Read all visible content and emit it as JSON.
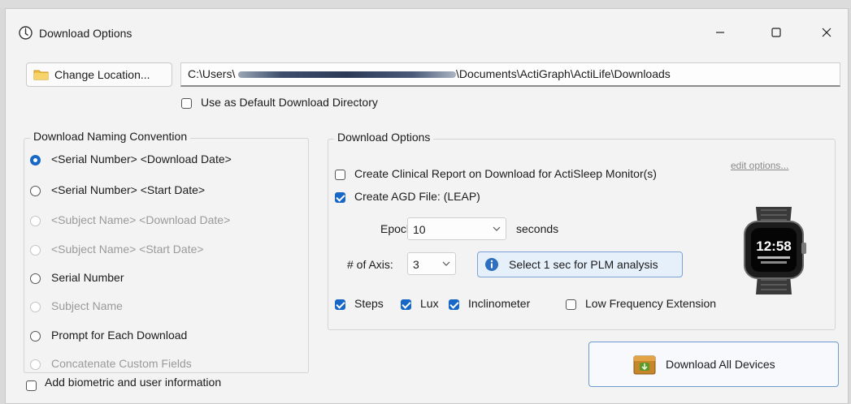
{
  "window": {
    "title": "Download Options",
    "icon": "download-clock-icon"
  },
  "controls": {
    "minimize_icon": "minimize-icon",
    "maximize_icon": "maximize-icon",
    "close_icon": "close-icon"
  },
  "location": {
    "button_label": "Change Location...",
    "path_prefix": "C:\\Users\\",
    "path_suffix": "\\Documents\\ActiGraph\\ActiLife\\Downloads",
    "default_label": "Use as Default Download Directory",
    "default_checked": false
  },
  "naming": {
    "title": "Download Naming Convention",
    "options": [
      {
        "label": "<Serial Number> <Download Date>",
        "selected": true,
        "disabled": false
      },
      {
        "label": "<Serial Number> <Start Date>",
        "selected": false,
        "disabled": false
      },
      {
        "label": "<Subject Name> <Download Date>",
        "selected": false,
        "disabled": true
      },
      {
        "label": "<Subject Name> <Start Date>",
        "selected": false,
        "disabled": true
      },
      {
        "label": "Serial Number",
        "selected": false,
        "disabled": false
      },
      {
        "label": "Subject Name",
        "selected": false,
        "disabled": true
      },
      {
        "label": "Prompt for Each Download",
        "selected": false,
        "disabled": false
      },
      {
        "label": "Concatenate Custom Fields",
        "selected": false,
        "disabled": true
      }
    ]
  },
  "biometric": {
    "label": "Add biometric and user information",
    "checked": false
  },
  "options": {
    "title": "Download Options",
    "clinical_label": "Create Clinical Report on Download for ActiSleep Monitor(s)",
    "clinical_checked": false,
    "edit_options_label": "edit options...",
    "agd_label": "Create AGD File: (LEAP)",
    "agd_checked": true,
    "epoch_label": "Epoch:",
    "epoch_value": "10",
    "epoch_units": "seconds",
    "axis_label": "# of Axis:",
    "axis_value": "3",
    "plm_button": "Select 1 sec for PLM analysis",
    "plm_icon": "info-icon",
    "steps_label": "Steps",
    "steps_checked": true,
    "lux_label": "Lux",
    "lux_checked": true,
    "incl_label": "Inclinometer",
    "incl_checked": true,
    "lfe_label": "Low Frequency Extension",
    "lfe_checked": false,
    "device_image": "actigraph-watch-image",
    "device_time": "12:58"
  },
  "download_all": {
    "label": "Download All Devices",
    "icon": "device-box-icon"
  },
  "colors": {
    "accent": "#1767c7",
    "window_bg": "#f3f3f3",
    "disabled_text": "#9a9a9a"
  }
}
